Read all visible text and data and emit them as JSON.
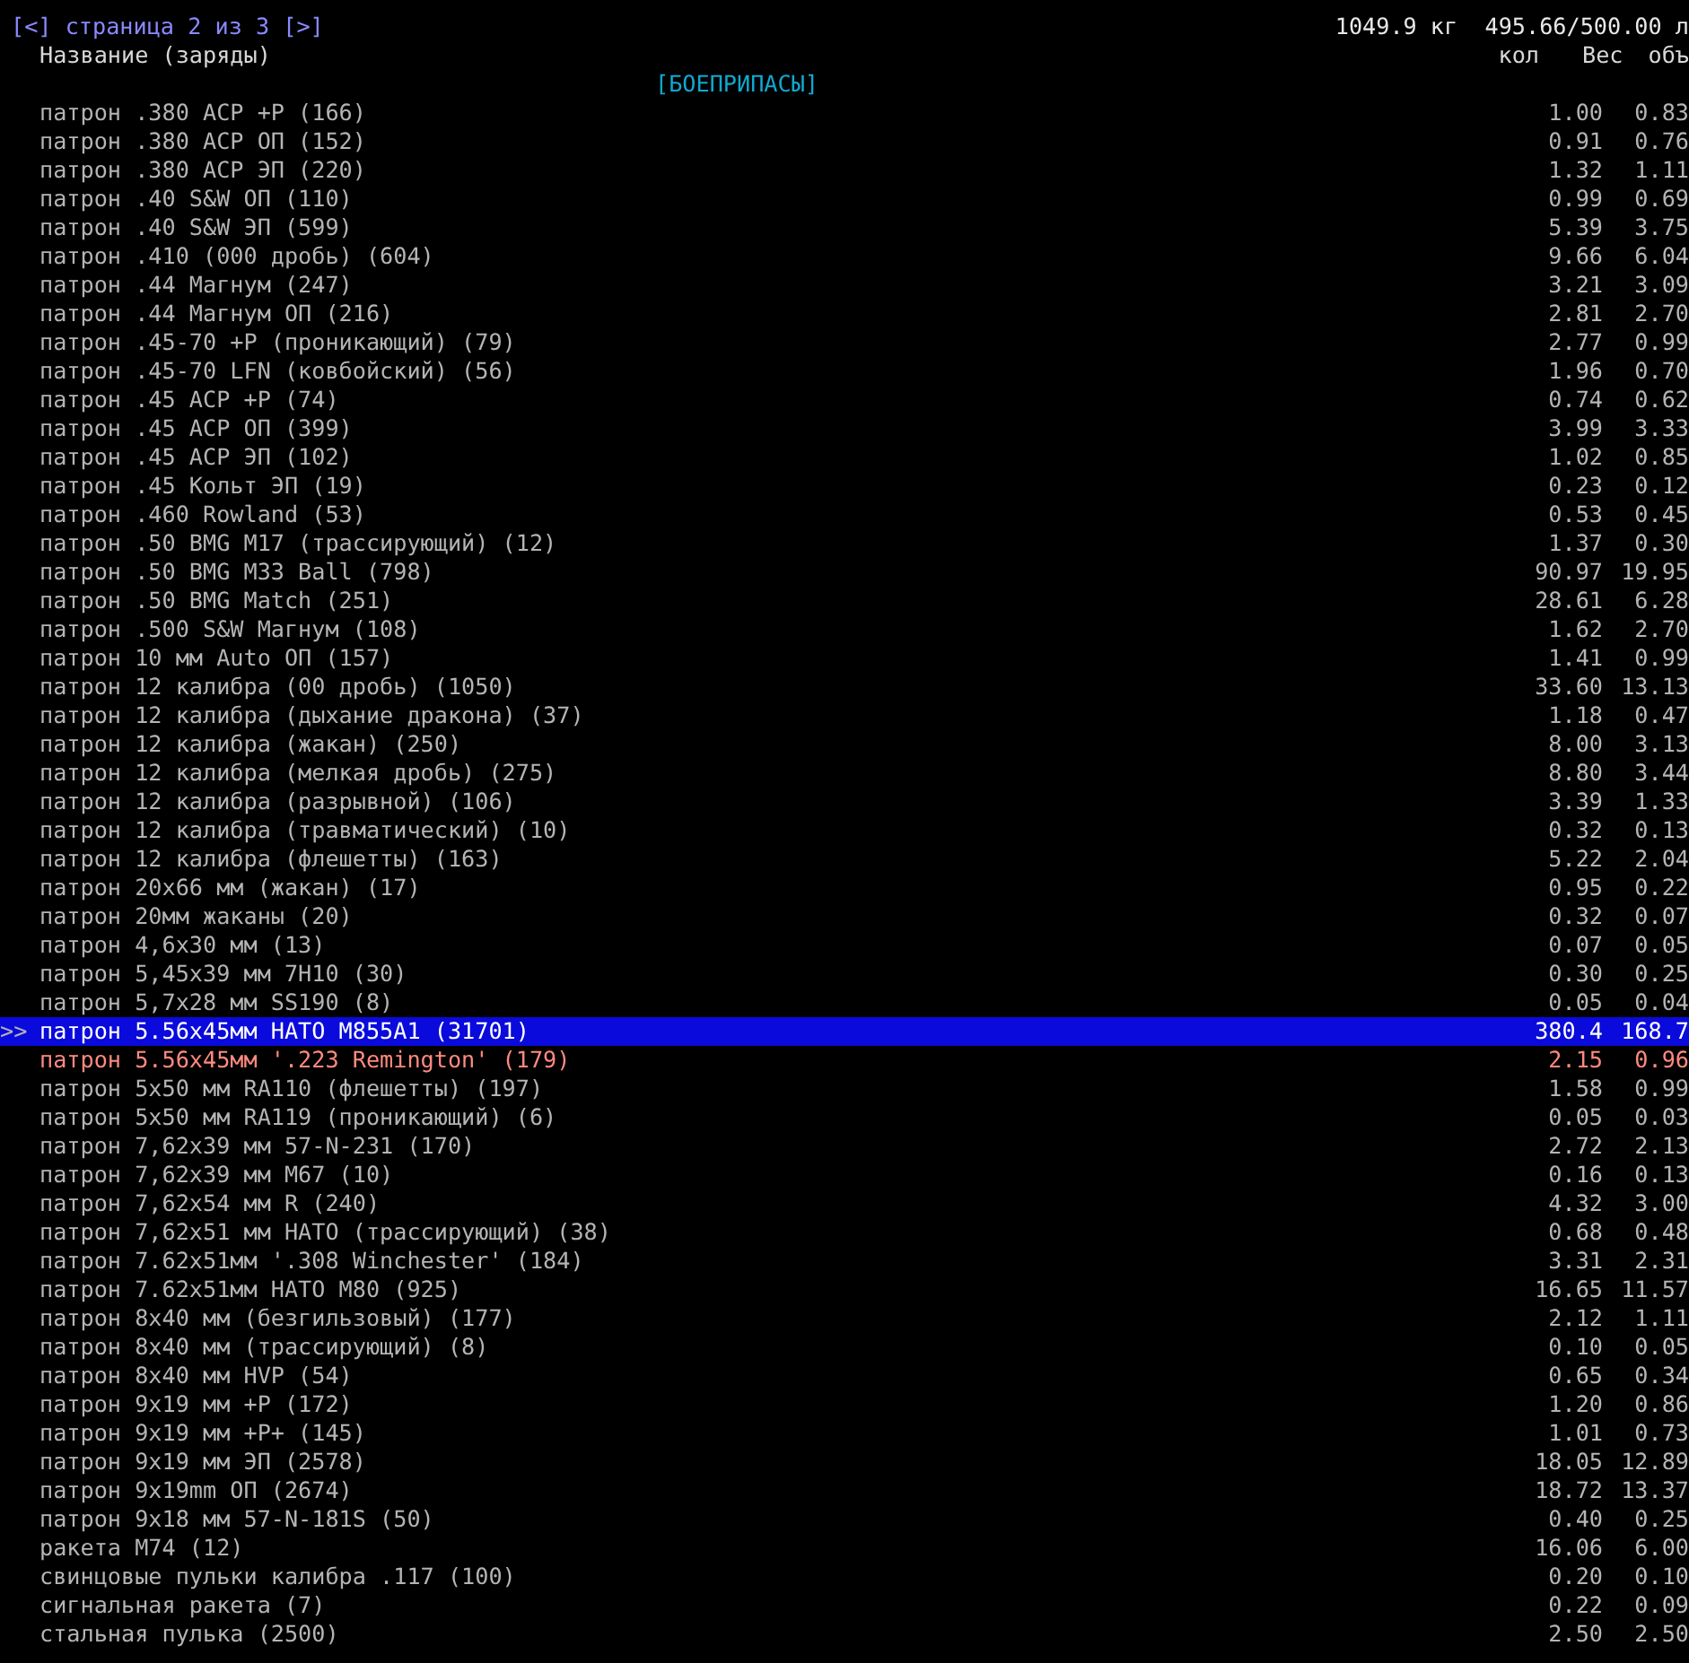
{
  "pager": "[<] страница 2 из 3 [>]",
  "totals": "1049.9 кг  495.66/500.00 л",
  "columns": {
    "name": "Название (заряды)",
    "qty": "кол",
    "weight": "Вес",
    "volume": "объ"
  },
  "section": "[БОЕПРИПАСЫ]",
  "cursor_marker": ">>",
  "rows": [
    {
      "name": "патрон .380 ACP +P (166)",
      "weight": "1.00",
      "volume": "0.83",
      "selected": false,
      "color": "#b4b4b4"
    },
    {
      "name": "патрон .380 ACP ОП (152)",
      "weight": "0.91",
      "volume": "0.76",
      "selected": false,
      "color": "#b4b4b4"
    },
    {
      "name": "патрон .380 ACP ЭП (220)",
      "weight": "1.32",
      "volume": "1.11",
      "selected": false,
      "color": "#b4b4b4"
    },
    {
      "name": "патрон .40 S&W ОП (110)",
      "weight": "0.99",
      "volume": "0.69",
      "selected": false,
      "color": "#b4b4b4"
    },
    {
      "name": "патрон .40 S&W ЭП (599)",
      "weight": "5.39",
      "volume": "3.75",
      "selected": false,
      "color": "#b4b4b4"
    },
    {
      "name": "патрон .410 (000 дробь) (604)",
      "weight": "9.66",
      "volume": "6.04",
      "selected": false,
      "color": "#b4b4b4"
    },
    {
      "name": "патрон .44 Магнум (247)",
      "weight": "3.21",
      "volume": "3.09",
      "selected": false,
      "color": "#b4b4b4"
    },
    {
      "name": "патрон .44 Магнум ОП (216)",
      "weight": "2.81",
      "volume": "2.70",
      "selected": false,
      "color": "#b4b4b4"
    },
    {
      "name": "патрон .45-70 +P (проникающий) (79)",
      "weight": "2.77",
      "volume": "0.99",
      "selected": false,
      "color": "#b4b4b4"
    },
    {
      "name": "патрон .45-70 LFN (ковбойский) (56)",
      "weight": "1.96",
      "volume": "0.70",
      "selected": false,
      "color": "#b4b4b4"
    },
    {
      "name": "патрон .45 ACP +P (74)",
      "weight": "0.74",
      "volume": "0.62",
      "selected": false,
      "color": "#b4b4b4"
    },
    {
      "name": "патрон .45 ACP ОП (399)",
      "weight": "3.99",
      "volume": "3.33",
      "selected": false,
      "color": "#b4b4b4"
    },
    {
      "name": "патрон .45 ACP ЭП (102)",
      "weight": "1.02",
      "volume": "0.85",
      "selected": false,
      "color": "#b4b4b4"
    },
    {
      "name": "патрон .45 Кольт ЭП (19)",
      "weight": "0.23",
      "volume": "0.12",
      "selected": false,
      "color": "#b4b4b4"
    },
    {
      "name": "патрон .460 Rowland (53)",
      "weight": "0.53",
      "volume": "0.45",
      "selected": false,
      "color": "#b4b4b4"
    },
    {
      "name": "патрон .50 BMG M17 (трассирующий) (12)",
      "weight": "1.37",
      "volume": "0.30",
      "selected": false,
      "color": "#b4b4b4"
    },
    {
      "name": "патрон .50 BMG M33 Ball (798)",
      "weight": "90.97",
      "volume": "19.95",
      "selected": false,
      "color": "#b4b4b4"
    },
    {
      "name": "патрон .50 BMG Match (251)",
      "weight": "28.61",
      "volume": "6.28",
      "selected": false,
      "color": "#b4b4b4"
    },
    {
      "name": "патрон .500 S&W Магнум (108)",
      "weight": "1.62",
      "volume": "2.70",
      "selected": false,
      "color": "#b4b4b4"
    },
    {
      "name": "патрон 10 мм Auto ОП (157)",
      "weight": "1.41",
      "volume": "0.99",
      "selected": false,
      "color": "#b4b4b4"
    },
    {
      "name": "патрон 12 калибра (00 дробь) (1050)",
      "weight": "33.60",
      "volume": "13.13",
      "selected": false,
      "color": "#b4b4b4"
    },
    {
      "name": "патрон 12 калибра (дыхание дракона) (37)",
      "weight": "1.18",
      "volume": "0.47",
      "selected": false,
      "color": "#b4b4b4"
    },
    {
      "name": "патрон 12 калибра (жакан) (250)",
      "weight": "8.00",
      "volume": "3.13",
      "selected": false,
      "color": "#b4b4b4"
    },
    {
      "name": "патрон 12 калибра (мелкая дробь) (275)",
      "weight": "8.80",
      "volume": "3.44",
      "selected": false,
      "color": "#b4b4b4"
    },
    {
      "name": "патрон 12 калибра (разрывной) (106)",
      "weight": "3.39",
      "volume": "1.33",
      "selected": false,
      "color": "#b4b4b4"
    },
    {
      "name": "патрон 12 калибра (травматический) (10)",
      "weight": "0.32",
      "volume": "0.13",
      "selected": false,
      "color": "#b4b4b4"
    },
    {
      "name": "патрон 12 калибра (флешетты) (163)",
      "weight": "5.22",
      "volume": "2.04",
      "selected": false,
      "color": "#b4b4b4"
    },
    {
      "name": "патрон 20x66 мм (жакан) (17)",
      "weight": "0.95",
      "volume": "0.22",
      "selected": false,
      "color": "#b4b4b4"
    },
    {
      "name": "патрон 20мм жаканы (20)",
      "weight": "0.32",
      "volume": "0.07",
      "selected": false,
      "color": "#b4b4b4"
    },
    {
      "name": "патрон 4,6x30 мм (13)",
      "weight": "0.07",
      "volume": "0.05",
      "selected": false,
      "color": "#b4b4b4"
    },
    {
      "name": "патрон 5,45x39 мм 7Н10 (30)",
      "weight": "0.30",
      "volume": "0.25",
      "selected": false,
      "color": "#b4b4b4"
    },
    {
      "name": "патрон 5,7x28 мм SS190 (8)",
      "weight": "0.05",
      "volume": "0.04",
      "selected": false,
      "color": "#b4b4b4"
    },
    {
      "name": "патрон 5.56x45мм НАТО M855A1 (31701)",
      "weight": "380.4",
      "volume": "168.7",
      "selected": true,
      "color": "#ffffff"
    },
    {
      "name": "патрон 5.56x45мм '.223 Remington' (179)",
      "weight": "2.15",
      "volume": "0.96",
      "selected": false,
      "color": "#ff8a80"
    },
    {
      "name": "патрон 5x50 мм RA110 (флешетты) (197)",
      "weight": "1.58",
      "volume": "0.99",
      "selected": false,
      "color": "#b4b4b4"
    },
    {
      "name": "патрон 5x50 мм RA119 (проникающий) (6)",
      "weight": "0.05",
      "volume": "0.03",
      "selected": false,
      "color": "#b4b4b4"
    },
    {
      "name": "патрон 7,62x39 мм 57-N-231 (170)",
      "weight": "2.72",
      "volume": "2.13",
      "selected": false,
      "color": "#b4b4b4"
    },
    {
      "name": "патрон 7,62x39 мм M67 (10)",
      "weight": "0.16",
      "volume": "0.13",
      "selected": false,
      "color": "#b4b4b4"
    },
    {
      "name": "патрон 7,62x54 мм R (240)",
      "weight": "4.32",
      "volume": "3.00",
      "selected": false,
      "color": "#b4b4b4"
    },
    {
      "name": "патрон 7,62x51 мм НАТО (трассирующий) (38)",
      "weight": "0.68",
      "volume": "0.48",
      "selected": false,
      "color": "#b4b4b4"
    },
    {
      "name": "патрон 7.62x51мм '.308 Winchester' (184)",
      "weight": "3.31",
      "volume": "2.31",
      "selected": false,
      "color": "#b4b4b4"
    },
    {
      "name": "патрон 7.62x51мм НАТО M80 (925)",
      "weight": "16.65",
      "volume": "11.57",
      "selected": false,
      "color": "#b4b4b4"
    },
    {
      "name": "патрон 8x40 мм (безгильзовый) (177)",
      "weight": "2.12",
      "volume": "1.11",
      "selected": false,
      "color": "#b4b4b4"
    },
    {
      "name": "патрон 8x40 мм (трассирующий) (8)",
      "weight": "0.10",
      "volume": "0.05",
      "selected": false,
      "color": "#b4b4b4"
    },
    {
      "name": "патрон 8x40 мм HVP (54)",
      "weight": "0.65",
      "volume": "0.34",
      "selected": false,
      "color": "#b4b4b4"
    },
    {
      "name": "патрон 9x19 мм +P (172)",
      "weight": "1.20",
      "volume": "0.86",
      "selected": false,
      "color": "#b4b4b4"
    },
    {
      "name": "патрон 9x19 мм +P+ (145)",
      "weight": "1.01",
      "volume": "0.73",
      "selected": false,
      "color": "#b4b4b4"
    },
    {
      "name": "патрон 9x19 мм ЭП (2578)",
      "weight": "18.05",
      "volume": "12.89",
      "selected": false,
      "color": "#b4b4b4"
    },
    {
      "name": "патрон 9x19mm ОП (2674)",
      "weight": "18.72",
      "volume": "13.37",
      "selected": false,
      "color": "#b4b4b4"
    },
    {
      "name": "патрон 9x18 мм 57-N-181S (50)",
      "weight": "0.40",
      "volume": "0.25",
      "selected": false,
      "color": "#b4b4b4"
    },
    {
      "name": "ракета M74 (12)",
      "weight": "16.06",
      "volume": "6.00",
      "selected": false,
      "color": "#b4b4b4"
    },
    {
      "name": "свинцовые пульки калибра .117 (100)",
      "weight": "0.20",
      "volume": "0.10",
      "selected": false,
      "color": "#b4b4b4"
    },
    {
      "name": "сигнальная ракета (7)",
      "weight": "0.22",
      "volume": "0.09",
      "selected": false,
      "color": "#b4b4b4"
    },
    {
      "name": "стальная пулька (2500)",
      "weight": "2.50",
      "volume": "2.50",
      "selected": false,
      "color": "#b4b4b4"
    }
  ]
}
